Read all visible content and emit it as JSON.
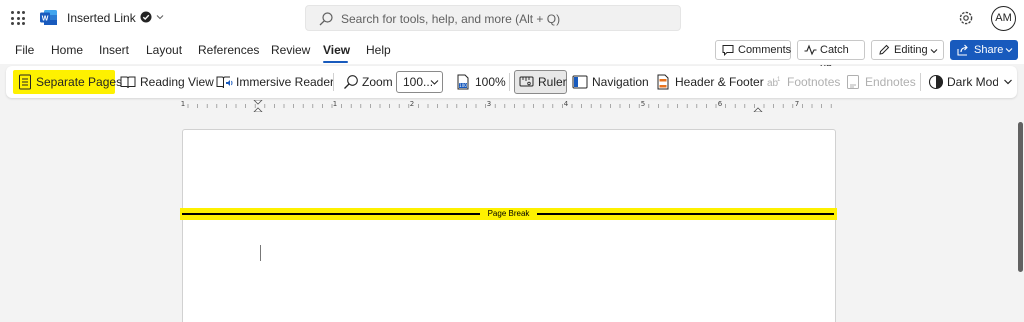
{
  "titlebar": {
    "doc_title": "Inserted Link",
    "search_placeholder": "Search for tools, help, and more (Alt + Q)",
    "avatar_initials": "AM"
  },
  "menu": {
    "items": [
      "File",
      "Home",
      "Insert",
      "Layout",
      "References",
      "Review",
      "View",
      "Help"
    ],
    "active": "View",
    "comments_label": "Comments",
    "catchup_label": "Catch up",
    "editing_label": "Editing",
    "share_label": "Share"
  },
  "ribbon": {
    "separate_pages": "Separate Pages",
    "reading_view": "Reading View",
    "immersive_reader": "Immersive Reader",
    "zoom": "Zoom",
    "zoom_value": "100...",
    "zoom_100": "100%",
    "ruler": "Ruler",
    "navigation": "Navigation",
    "header_footer": "Header & Footer",
    "footnotes": "Footnotes",
    "endnotes": "Endnotes",
    "dark_mode": "Dark Mod"
  },
  "ruler": {
    "numbers": [
      "1",
      "1",
      "2",
      "3",
      "4",
      "5",
      "6",
      "7"
    ]
  },
  "document": {
    "page_break_label": "Page Break"
  },
  "colors": {
    "highlight": "#fef100",
    "accent": "#185abd"
  }
}
